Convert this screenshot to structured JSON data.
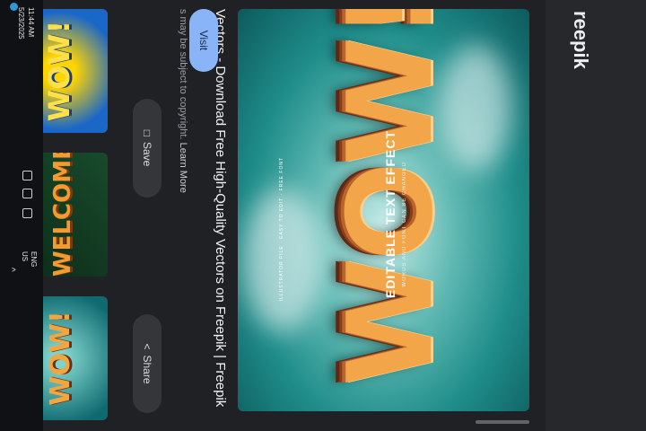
{
  "site": {
    "brand": "reepik"
  },
  "preview": {
    "big_text": "WOW!",
    "headline": "EDITABLE TEXT EFFECT",
    "subline": "WORDS AND FONT CAN BE CHANGED",
    "note": "ILLUSTRATOR FILE · EASY TO EDIT · FREE FONT"
  },
  "result": {
    "title": "Vectors - Download Free High-Quality Vectors on Freepik | Freepik",
    "disclaimer": "s may be subject to copyright.",
    "learn_more": "Learn More"
  },
  "buttons": {
    "visit": "Visit",
    "share": "Share",
    "save": "Save"
  },
  "thumbnails": [
    "WOW!",
    "WELCOME",
    "WOW!"
  ],
  "taskbar": {
    "language": "ENG US",
    "time": "11:44 AM",
    "date": "5/23/2025"
  },
  "colors": {
    "accent": "#8ab4f8",
    "preview_teal": "#1f8d8a",
    "wow_orange": "#f3a54a"
  }
}
